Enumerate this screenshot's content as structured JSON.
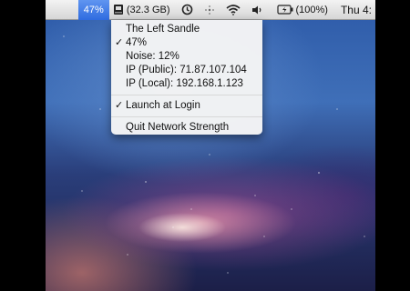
{
  "menubar": {
    "network_strength": "47%",
    "disk_space": "(32.3 GB)",
    "battery_text": "(100%)",
    "clock": "Thu 4:"
  },
  "dropdown": {
    "items": [
      {
        "label": "The Left Sandle",
        "checked": false
      },
      {
        "label": "47%",
        "checked": true
      },
      {
        "label": "Noise: 12%",
        "checked": false
      },
      {
        "label": "IP (Public): 71.87.107.104",
        "checked": false
      },
      {
        "label": "IP (Local): 192.168.1.123",
        "checked": false
      }
    ],
    "launch_at_login": {
      "label": "Launch at Login",
      "checked": true
    },
    "quit": {
      "label": "Quit Network Strength"
    },
    "checkmark": "✓"
  },
  "icons": {
    "disk": "disk-icon",
    "time_machine": "time-machine-icon",
    "bluetooth": "bluetooth-icon",
    "wifi": "wifi-icon",
    "volume": "volume-icon",
    "battery": "battery-icon"
  }
}
